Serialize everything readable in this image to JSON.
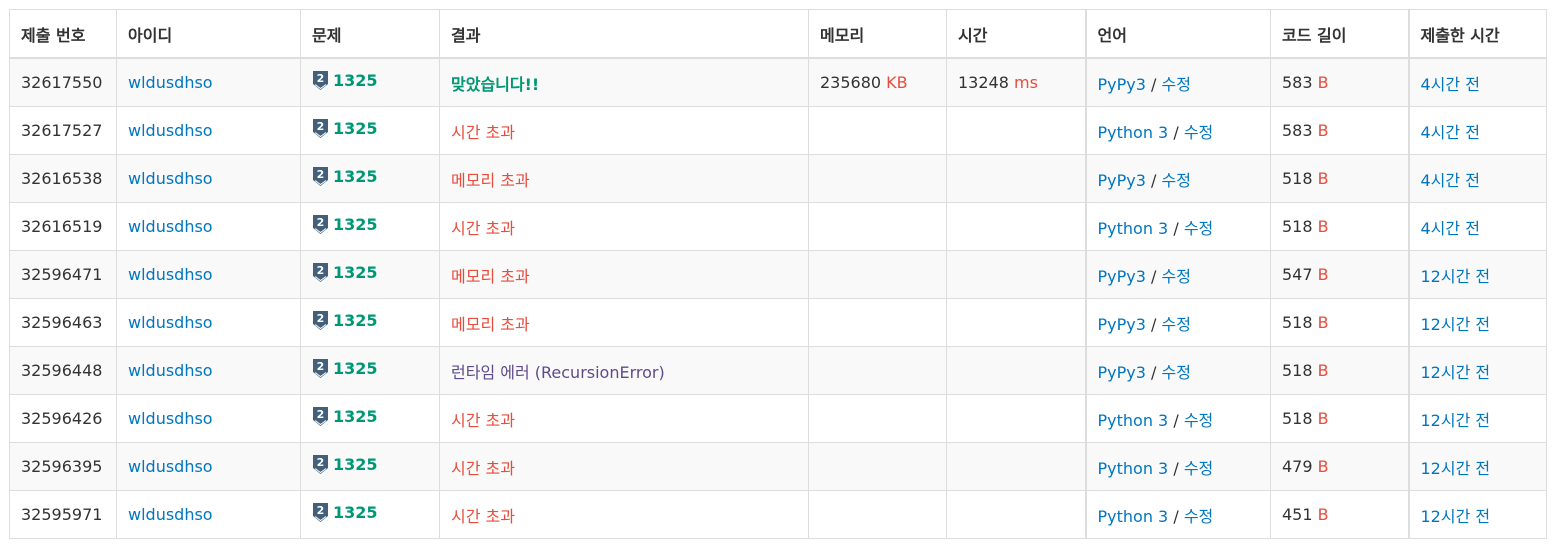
{
  "columns": [
    "제출 번호",
    "아이디",
    "문제",
    "결과",
    "메모리",
    "시간",
    "언어",
    "코드 길이",
    "제출한 시간"
  ],
  "edit_label": "수정",
  "units": {
    "memory": "KB",
    "time": "ms",
    "code": "B"
  },
  "tier_icon": {
    "name": "silver-2-tier-icon",
    "label": "2",
    "color": "#435f7a"
  },
  "colors": {
    "link": "#0076c0",
    "accepted": "#009874",
    "error": "#e74c3c",
    "runtime_error": "#5f4b8b"
  },
  "rows": [
    {
      "id": "32617550",
      "user": "wldusdhso",
      "problem": "1325",
      "result": "맞았습니다!!",
      "result_type": "ok",
      "memory": "235680",
      "time": "13248",
      "lang": "PyPy3",
      "code_len": "583",
      "submitted": "4시간 전"
    },
    {
      "id": "32617527",
      "user": "wldusdhso",
      "problem": "1325",
      "result": "시간 초과",
      "result_type": "tle",
      "memory": "",
      "time": "",
      "lang": "Python 3",
      "code_len": "583",
      "submitted": "4시간 전"
    },
    {
      "id": "32616538",
      "user": "wldusdhso",
      "problem": "1325",
      "result": "메모리 초과",
      "result_type": "mle",
      "memory": "",
      "time": "",
      "lang": "PyPy3",
      "code_len": "518",
      "submitted": "4시간 전"
    },
    {
      "id": "32616519",
      "user": "wldusdhso",
      "problem": "1325",
      "result": "시간 초과",
      "result_type": "tle",
      "memory": "",
      "time": "",
      "lang": "Python 3",
      "code_len": "518",
      "submitted": "4시간 전"
    },
    {
      "id": "32596471",
      "user": "wldusdhso",
      "problem": "1325",
      "result": "메모리 초과",
      "result_type": "mle",
      "memory": "",
      "time": "",
      "lang": "PyPy3",
      "code_len": "547",
      "submitted": "12시간 전"
    },
    {
      "id": "32596463",
      "user": "wldusdhso",
      "problem": "1325",
      "result": "메모리 초과",
      "result_type": "mle",
      "memory": "",
      "time": "",
      "lang": "PyPy3",
      "code_len": "518",
      "submitted": "12시간 전"
    },
    {
      "id": "32596448",
      "user": "wldusdhso",
      "problem": "1325",
      "result": "런타임 에러 (RecursionError)",
      "result_type": "rte",
      "memory": "",
      "time": "",
      "lang": "PyPy3",
      "code_len": "518",
      "submitted": "12시간 전"
    },
    {
      "id": "32596426",
      "user": "wldusdhso",
      "problem": "1325",
      "result": "시간 초과",
      "result_type": "tle",
      "memory": "",
      "time": "",
      "lang": "Python 3",
      "code_len": "518",
      "submitted": "12시간 전"
    },
    {
      "id": "32596395",
      "user": "wldusdhso",
      "problem": "1325",
      "result": "시간 초과",
      "result_type": "tle",
      "memory": "",
      "time": "",
      "lang": "Python 3",
      "code_len": "479",
      "submitted": "12시간 전"
    },
    {
      "id": "32595971",
      "user": "wldusdhso",
      "problem": "1325",
      "result": "시간 초과",
      "result_type": "tle",
      "memory": "",
      "time": "",
      "lang": "Python 3",
      "code_len": "451",
      "submitted": "12시간 전"
    }
  ]
}
